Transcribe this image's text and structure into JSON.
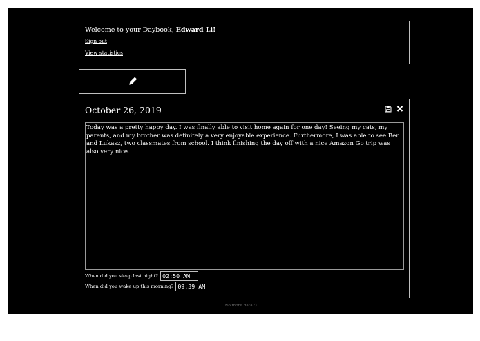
{
  "header": {
    "welcome_text": "Welcome to your Daybook,",
    "user_name": "Edward Li!",
    "sign_out_label": "Sign out",
    "statistics_label": "View statistics"
  },
  "new_entry": {
    "icon": "pencil-icon"
  },
  "entry": {
    "date": "October 26, 2019",
    "save_icon": "save-icon",
    "close_icon": "close-icon",
    "text": "Today was a pretty happy day. I was finally able to visit home again for one day! Seeing my cats, my parents, and my brother was definitely a very enjoyable experience. Furthermore, I was able to see Ben and Lukasz, two classmates from school. I think finishing the day off with a nice Amazon Go trip was also very nice.",
    "sleep_question": "When did you sleep last night?",
    "sleep_time": "02:50 AM",
    "wake_question": "When did you wake up this morning?",
    "wake_time": "09:39 AM"
  },
  "footer": {
    "note": "No more data :)"
  },
  "colors": {
    "background": "#000000",
    "text": "#ffffff",
    "border": "#bfbfbf",
    "muted": "#6f6f6f"
  }
}
